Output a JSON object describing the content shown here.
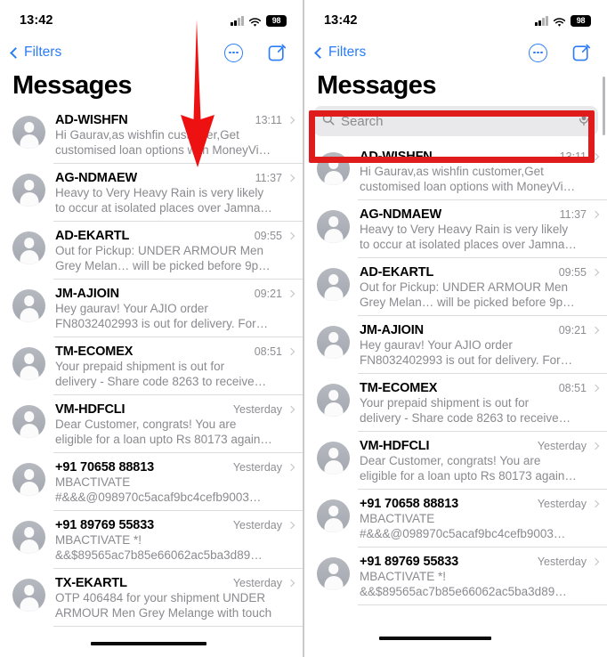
{
  "status_bar": {
    "clock": "13:42",
    "battery_level": "98",
    "cellular_icon": "signal-bars-icon",
    "wifi_icon": "wifi-icon",
    "battery_icon": "battery-icon"
  },
  "nav_bar": {
    "back_label": "Filters",
    "back_icon": "chevron-left-icon",
    "more_icon": "circle-ellipsis-icon",
    "compose_icon": "compose-icon"
  },
  "page_title": "Messages",
  "search": {
    "placeholder": "Search",
    "search_icon": "magnifier-icon",
    "dictation_icon": "microphone-icon"
  },
  "colors": {
    "accent_blue": "#2b7cf6",
    "annotation_red": "#e01b1b",
    "avatar_gray": "#a9acb4",
    "secondary_text": "#8a8a8f",
    "search_field_bg": "#e9e9eb"
  },
  "annotations": {
    "arrow": {
      "name": "red-down-arrow",
      "description": "red downward arrow pointing at the top of the message list"
    },
    "highlight_box": {
      "name": "red-highlight-box",
      "description": "red rectangle around the Search field"
    }
  },
  "messages": [
    {
      "sender": "AD-WISHFN",
      "time": "13:11",
      "preview_line1": "Hi Gaurav,as wishfin customer,Get",
      "preview_line2": "customised loan options with MoneyVi…"
    },
    {
      "sender": "AG-NDMAEW",
      "time": "11:37",
      "preview_line1": "Heavy to Very Heavy Rain is very likely",
      "preview_line2": "to occur at isolated places over Jamna…"
    },
    {
      "sender": "AD-EKARTL",
      "time": "09:55",
      "preview_line1": "Out for Pickup: UNDER ARMOUR Men",
      "preview_line2": "Grey Melan… will be picked before 9p…"
    },
    {
      "sender": "JM-AJIOIN",
      "time": "09:21",
      "preview_line1": "Hey gaurav! Your AJIO order",
      "preview_line2": "FN8032402993 is out for delivery. For…"
    },
    {
      "sender": "TM-ECOMEX",
      "time": "08:51",
      "preview_line1": "Your prepaid shipment is out for",
      "preview_line2": "delivery - Share code 8263 to receive…"
    },
    {
      "sender": "VM-HDFCLI",
      "time": "Yesterday",
      "preview_line1": "Dear Customer, congrats! You are",
      "preview_line2": "eligible for a loan upto Rs 80173 again…"
    },
    {
      "sender": "+91 70658 88813",
      "time": "Yesterday",
      "preview_line1": "MBACTIVATE",
      "preview_line2": "#&&&@098970c5acaf9bc4cefb9003…"
    },
    {
      "sender": "+91 89769 55833",
      "time": "Yesterday",
      "preview_line1": "MBACTIVATE *!",
      "preview_line2": "&&$89565ac7b85e66062ac5ba3d89…"
    },
    {
      "sender": "TX-EKARTL",
      "time": "Yesterday",
      "preview_line1": "OTP 406484 for your shipment UNDER",
      "preview_line2": "ARMOUR Men Grey Melange with touch"
    }
  ]
}
